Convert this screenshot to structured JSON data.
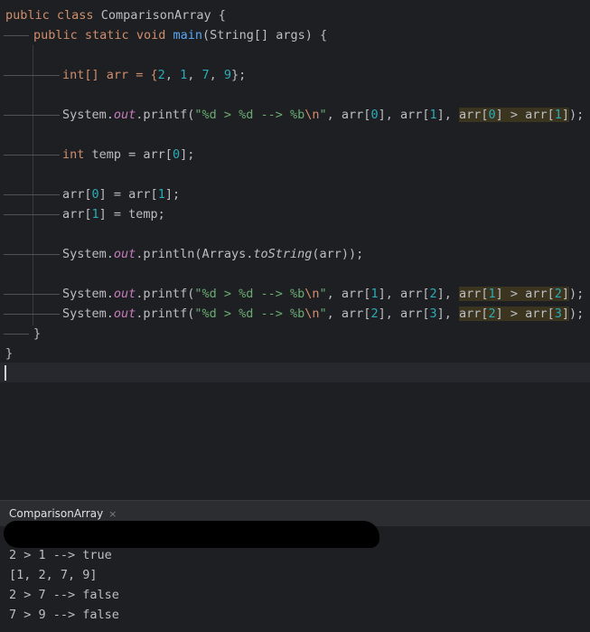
{
  "editor": {
    "l1": {
      "kw1": "public",
      "kw2": "class",
      "name": "ComparisonArray",
      "brace": " {"
    },
    "l2": {
      "kw1": "public",
      "kw2": "static",
      "kw3": "void",
      "fn": "main",
      "rest": "(String[] args) {"
    },
    "l4": {
      "a": "int[] arr = {",
      "n1": "2",
      "c1": ", ",
      "n2": "1",
      "c2": ", ",
      "n3": "7",
      "c3": ", ",
      "n4": "9",
      "end": "};"
    },
    "l6": {
      "a": "System.",
      "out": "out",
      "b": ".printf(",
      "s1": "\"%d > %d --> %b",
      "esc": "\\n",
      "s2": "\"",
      "c": ", arr[",
      "i1": "0",
      "d": "], arr[",
      "i2": "1",
      "e": "], ",
      "h1": "arr[",
      "hi1": "0",
      "h2": "] > arr[",
      "hi2": "1",
      "h3": "]",
      "end": ");"
    },
    "l8": {
      "kw": "int",
      "a": " temp = arr[",
      "n": "0",
      "end": "];"
    },
    "l10": {
      "a": "arr[",
      "n1": "0",
      "b": "] = arr[",
      "n2": "1",
      "end": "];"
    },
    "l11": {
      "a": "arr[",
      "n1": "1",
      "b": "] = temp;"
    },
    "l13": {
      "a": "System.",
      "out": "out",
      "b": ".println(Arrays.",
      "fn": "toString",
      "end": "(arr));"
    },
    "l15": {
      "a": "System.",
      "out": "out",
      "b": ".printf(",
      "s1": "\"%d > %d --> %b",
      "esc": "\\n",
      "s2": "\"",
      "c": ", arr[",
      "i1": "1",
      "d": "], arr[",
      "i2": "2",
      "e": "], ",
      "h1": "arr[",
      "hi1": "1",
      "h2": "] > arr[",
      "hi2": "2",
      "h3": "]",
      "end": ");"
    },
    "l16": {
      "a": "System.",
      "out": "out",
      "b": ".printf(",
      "s1": "\"%d > %d --> %b",
      "esc": "\\n",
      "s2": "\"",
      "c": ", arr[",
      "i1": "2",
      "d": "], arr[",
      "i2": "3",
      "e": "], ",
      "h1": "arr[",
      "hi1": "2",
      "h2": "] > arr[",
      "hi2": "3",
      "h3": "]",
      "end": ");"
    },
    "l17": {
      "brace": "}"
    },
    "l18": {
      "brace": "}"
    }
  },
  "run_panel": {
    "tab_label": "ComparisonArray",
    "close_icon": "×",
    "output": [
      "2 > 1 --> true",
      "[1, 2, 7, 9]",
      "2 > 7 --> false",
      "7 > 9 --> false"
    ]
  },
  "colors": {
    "keyword": "#cf8e6d",
    "number": "#2aacb8",
    "string": "#6aab73",
    "static_field": "#c77dbb",
    "method": "#56a8f5",
    "highlight": "#3b3520"
  }
}
